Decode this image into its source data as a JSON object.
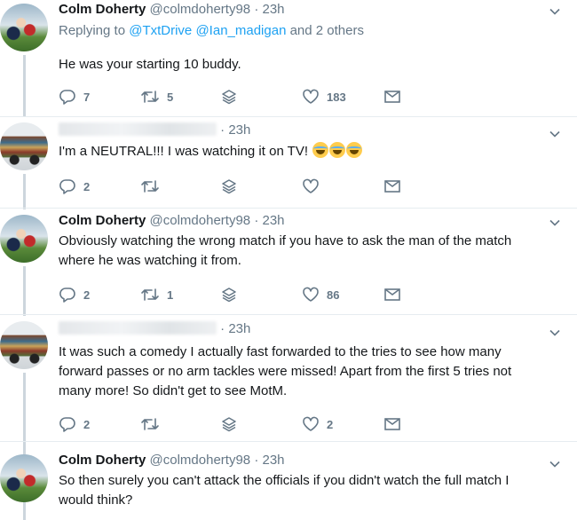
{
  "tweets": [
    {
      "name": "Colm Doherty",
      "handle": "@colmdoherty98",
      "time": "23h",
      "replying_prefix": "Replying to",
      "replying_user1": "@TxtDrive",
      "replying_user2": "@Ian_madigan",
      "replying_suffix": "and 2 others",
      "text": "He was your starting 10 buddy.",
      "replies": "7",
      "retweets": "5",
      "likes": "183"
    },
    {
      "name": "",
      "handle": "",
      "time": "23h",
      "text": "I'm a NEUTRAL!!! I was watching it on TV!",
      "emojis": [
        "face-with-tears-of-joy",
        "face-with-tears-of-joy",
        "face-with-tears-of-joy"
      ],
      "replies": "2",
      "retweets": "",
      "likes": ""
    },
    {
      "name": "Colm Doherty",
      "handle": "@colmdoherty98",
      "time": "23h",
      "text_line1": "Obviously watching the wrong match if you have to ask the man of the match",
      "text_line2": "where he was watching it from.",
      "replies": "2",
      "retweets": "1",
      "likes": "86"
    },
    {
      "name": "",
      "handle": "",
      "time": "23h",
      "text_line1": "It was such a comedy I actually fast forwarded to the tries to see how many",
      "text_line2": "forward passes or no arm tackles were missed! Apart from the first 5 tries not",
      "text_line3": "many more! So didn't get to see MotM.",
      "replies": "2",
      "retweets": "",
      "likes": "2"
    },
    {
      "name": "Colm Doherty",
      "handle": "@colmdoherty98",
      "time": "23h",
      "text_line1": "So then surely you can't attack the officials if you didn't watch the full match I",
      "text_line2": "would think?"
    }
  ],
  "separator": "·",
  "colors": {
    "link": "#1da1f2",
    "muted": "#657786",
    "text": "#14171a",
    "divider": "#e6ecf0"
  }
}
